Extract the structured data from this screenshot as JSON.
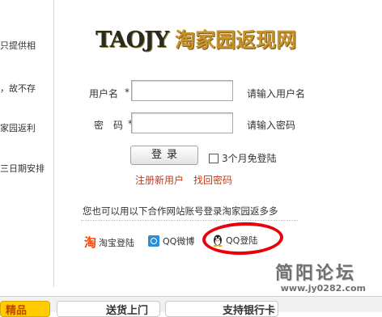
{
  "sidebar": {
    "lines": [
      "只提供相",
      "，故不存",
      "家园返利",
      "三日期安排"
    ]
  },
  "logo": {
    "latin": "TAOJY",
    "chinese": "淘家园返现网"
  },
  "form": {
    "username_label": "用户名",
    "username_required": "*",
    "username_value": "",
    "username_hint": "请输入用户名",
    "password_label": "密　码",
    "password_required": "*",
    "password_value": "",
    "password_hint": "请输入密码",
    "login_button": "登录",
    "remember_label": "3个月免登陆",
    "register_link": "注册新用户",
    "forgot_link": "找回密码"
  },
  "partners": {
    "text": "您也可以用以下合作网站账号登录淘家园返多多",
    "items": [
      {
        "icon": "taobao-icon",
        "glyph": "淘",
        "label": "淘宝登陆"
      },
      {
        "icon": "qq-weibo-icon",
        "label": "QQ微博"
      },
      {
        "icon": "qq-penguin-icon",
        "label": "QQ登陆"
      }
    ]
  },
  "annotation": {
    "color": "#e8000b"
  },
  "watermark": {
    "title": "简阳论坛",
    "url": "www.jy0282.com"
  },
  "bottom": {
    "cards": [
      "精品",
      "送货上门",
      "支持银行卡"
    ]
  },
  "colors": {
    "accent_link": "#c43a1b",
    "logo_gold": "#c9932b"
  }
}
